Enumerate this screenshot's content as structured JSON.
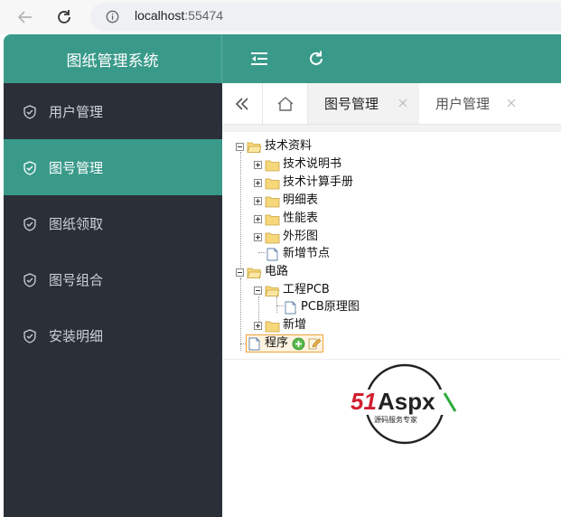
{
  "browser": {
    "url_host": "localhost",
    "url_port": ":55474"
  },
  "app": {
    "title": "图纸管理系统"
  },
  "sidebar": {
    "items": [
      {
        "label": "用户管理"
      },
      {
        "label": "图号管理"
      },
      {
        "label": "图纸领取"
      },
      {
        "label": "图号组合"
      },
      {
        "label": "安装明细"
      }
    ],
    "active_index": 1
  },
  "tabs": [
    {
      "label": "图号管理",
      "active": true
    },
    {
      "label": "用户管理",
      "active": false
    }
  ],
  "tree": {
    "nodes": [
      {
        "label": "技术资料"
      },
      {
        "label": "技术说明书"
      },
      {
        "label": "技术计算手册"
      },
      {
        "label": "明细表"
      },
      {
        "label": "性能表"
      },
      {
        "label": "外形图"
      },
      {
        "label": "新增节点"
      },
      {
        "label": "电路"
      },
      {
        "label": "工程PCB"
      },
      {
        "label": "PCB原理图"
      },
      {
        "label": "新增"
      },
      {
        "label": "程序"
      }
    ]
  },
  "logo": {
    "text_main": "51Aspx",
    "text_sub": "源码服务专家"
  },
  "colors": {
    "accent": "#3a9a8a",
    "sidebar_bg": "#2a2f38"
  }
}
